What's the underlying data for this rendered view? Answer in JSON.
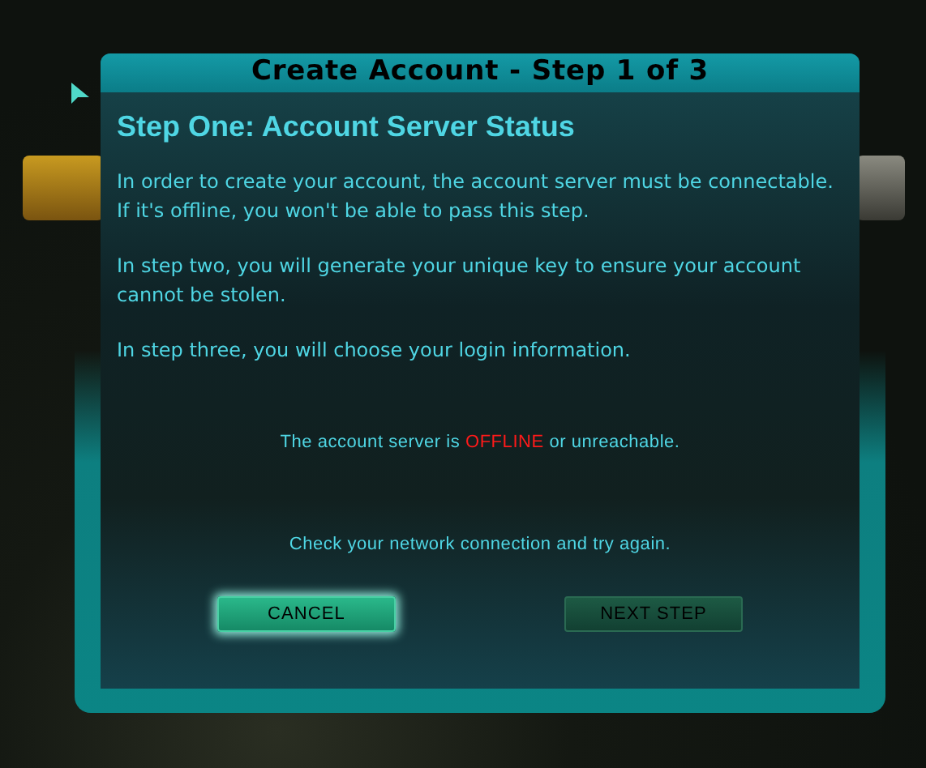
{
  "dialog": {
    "title": "Create Account - Step 1 of 3",
    "heading": "Step One: Account Server Status",
    "paragraphs": [
      "In order to create your account, the account server must be connectable.  If it's offline, you won't be able to pass this step.",
      "In step two, you will generate your unique key to ensure your account cannot be stolen.",
      "In step three, you will choose your login information."
    ],
    "status_message": "The account server is **OFFLINE** or unreachable.",
    "hint": "Check your network connection and try again.",
    "buttons": [
      {
        "label": "CANCEL",
        "focused": true,
        "disabled": false
      },
      {
        "label": "NEXT STEP",
        "focused": false,
        "disabled": true
      }
    ]
  }
}
